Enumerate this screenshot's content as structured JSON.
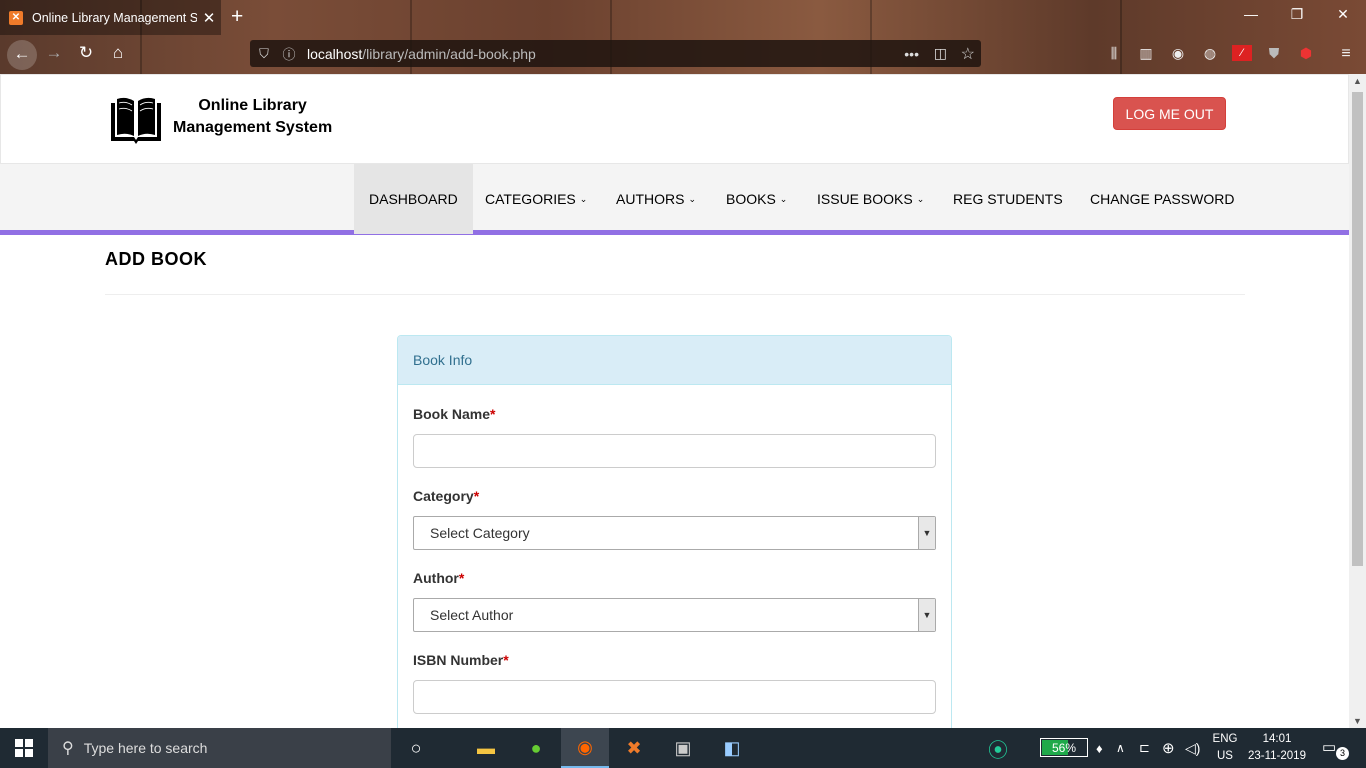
{
  "browser": {
    "tab_title": "Online Library Management Sy",
    "tab_favicon": "xampp-icon",
    "new_tab": "+",
    "url_host": "localhost",
    "url_path": "/library/admin/add-book.php",
    "url_dots": "•••"
  },
  "header": {
    "logo_line1": "Online Library",
    "logo_line2": "Management System",
    "logout_label": "LOG ME OUT"
  },
  "menu": {
    "items": [
      {
        "label": "DASHBOARD",
        "dropdown": false
      },
      {
        "label": "CATEGORIES",
        "dropdown": true
      },
      {
        "label": "AUTHORS",
        "dropdown": true
      },
      {
        "label": "BOOKS",
        "dropdown": true
      },
      {
        "label": "ISSUE BOOKS",
        "dropdown": true
      },
      {
        "label": "REG STUDENTS",
        "dropdown": false
      },
      {
        "label": "CHANGE PASSWORD",
        "dropdown": false
      }
    ],
    "caret": "⌄"
  },
  "page": {
    "title": "ADD BOOK"
  },
  "form": {
    "panel_heading": "Book Info",
    "book_name_label": "Book Name",
    "category_label": "Category",
    "category_selected": "Select Category",
    "author_label": "Author",
    "author_selected": "Select Author",
    "isbn_label": "ISBN Number",
    "required_mark": "*"
  },
  "taskbar": {
    "search_placeholder": "Type here to search",
    "battery": "56%",
    "battery_level": 0.56,
    "lang_line1": "ENG",
    "lang_line2": "US",
    "time": "14:01",
    "date": "23-11-2019",
    "notifications": "3"
  },
  "colors": {
    "accent_purple": "#9170e4",
    "logout_red": "#d9534f",
    "panel_info_bg": "#d9edf7",
    "panel_info_text": "#31708f"
  }
}
